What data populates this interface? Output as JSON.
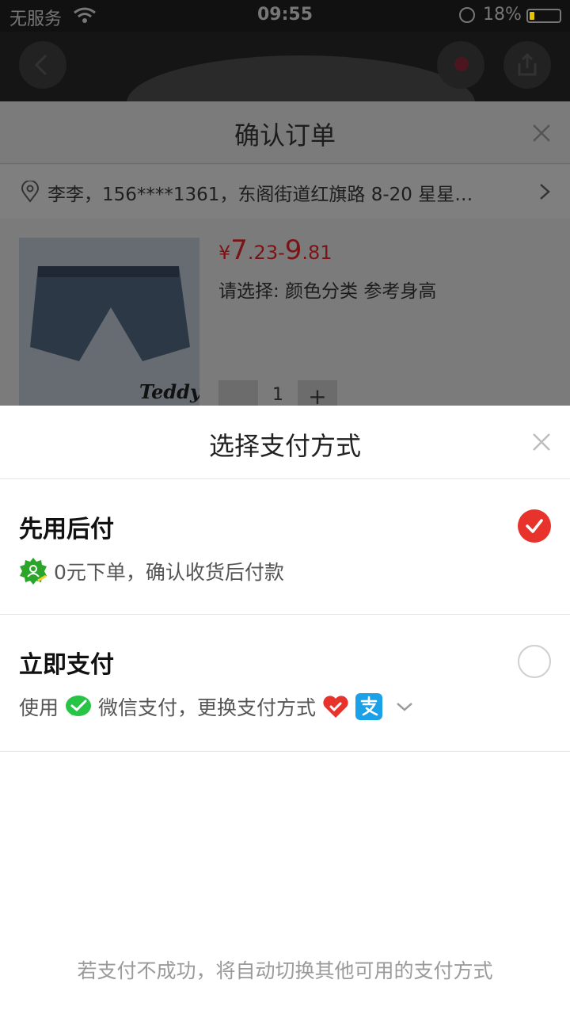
{
  "status_bar": {
    "carrier": "无服务",
    "time": "09:55",
    "battery": "18%"
  },
  "order": {
    "title": "确认订单",
    "address": "李李，156****1361，东阁街道红旗路 8-20 星星…",
    "product": {
      "brand": "Teddy",
      "price_currency": "¥",
      "price_low_int": "7",
      "price_low_dec": ".23",
      "price_sep": "-",
      "price_high_int": "9",
      "price_high_dec": ".81",
      "spec_label": "请选择: 颜色分类 参考身高",
      "quantity": "1",
      "plus": "+"
    }
  },
  "payment": {
    "title": "选择支付方式",
    "options": [
      {
        "title": "先用后付",
        "subtitle": "0元下单，确认收货后付款",
        "selected": true,
        "icon": "badge-person-icon"
      },
      {
        "title": "立即支付",
        "sub_prefix": "使用",
        "sub_method": "微信支付，更换支付方式",
        "selected": false,
        "icons": [
          "wechat-pay-icon",
          "heart-pay-icon",
          "alipay-icon",
          "chevron-down-icon"
        ]
      }
    ],
    "footer_note": "若支付不成功，将自动切换其他可用的支付方式"
  },
  "colors": {
    "accent_red": "#e7332b",
    "wechat_green": "#28c445",
    "alipay_blue": "#1aa1e8",
    "badge_green": "#2aa52a"
  }
}
